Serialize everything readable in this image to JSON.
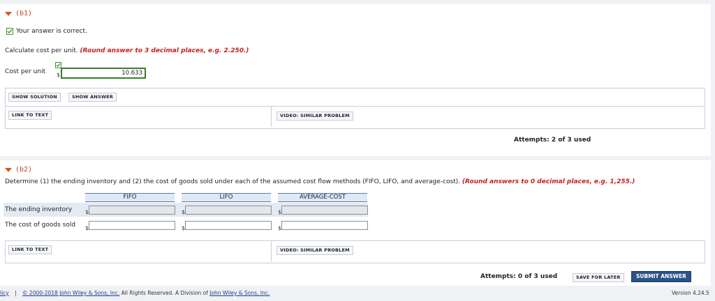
{
  "b1": {
    "heading": "(b1)",
    "correct_msg": "Your answer is correct.",
    "instruction": "Calculate cost per unit.",
    "round_note": "(Round answer to 3 decimal places, e.g. 2.250.)",
    "field_label": "Cost per unit",
    "currency": "$",
    "value": "10.633",
    "show_solution": "SHOW SOLUTION",
    "show_answer": "SHOW ANSWER",
    "link_to_text": "LINK TO TEXT",
    "video": "VIDEO: SIMILAR PROBLEM",
    "attempts": "Attempts: 2 of 3 used"
  },
  "b2": {
    "heading": "(b2)",
    "instruction": "Determine (1) the ending inventory and (2) the cost of goods sold under each of the assumed cost flow methods (FIFO, LIFO, and average-cost).",
    "round_note": "(Round answers to 0 decimal places, e.g. 1,255.)",
    "columns": [
      "FIFO",
      "LIFO",
      "AVERAGE-COST"
    ],
    "rows": [
      "The ending inventory",
      "The cost of goods sold"
    ],
    "currency": "$",
    "link_to_text": "LINK TO TEXT",
    "video": "VIDEO: SIMILAR PROBLEM",
    "attempts": "Attempts: 0 of 3 used",
    "save_later": "SAVE FOR LATER",
    "submit": "SUBMIT ANSWER"
  },
  "footer": {
    "policy": "licy",
    "sep": "|",
    "copyright_link": "© 2000-2018 John Wiley & Sons, Inc.",
    "rights": " All Rights Reserved. A Division of ",
    "division_link": "John Wiley & Sons, Inc.",
    "version": "Version 4.24.5"
  },
  "colors": {
    "accent": "#d9531e",
    "warning_red": "#c82020",
    "submit_blue": "#2c5387",
    "check_green": "#3f8f2f"
  }
}
